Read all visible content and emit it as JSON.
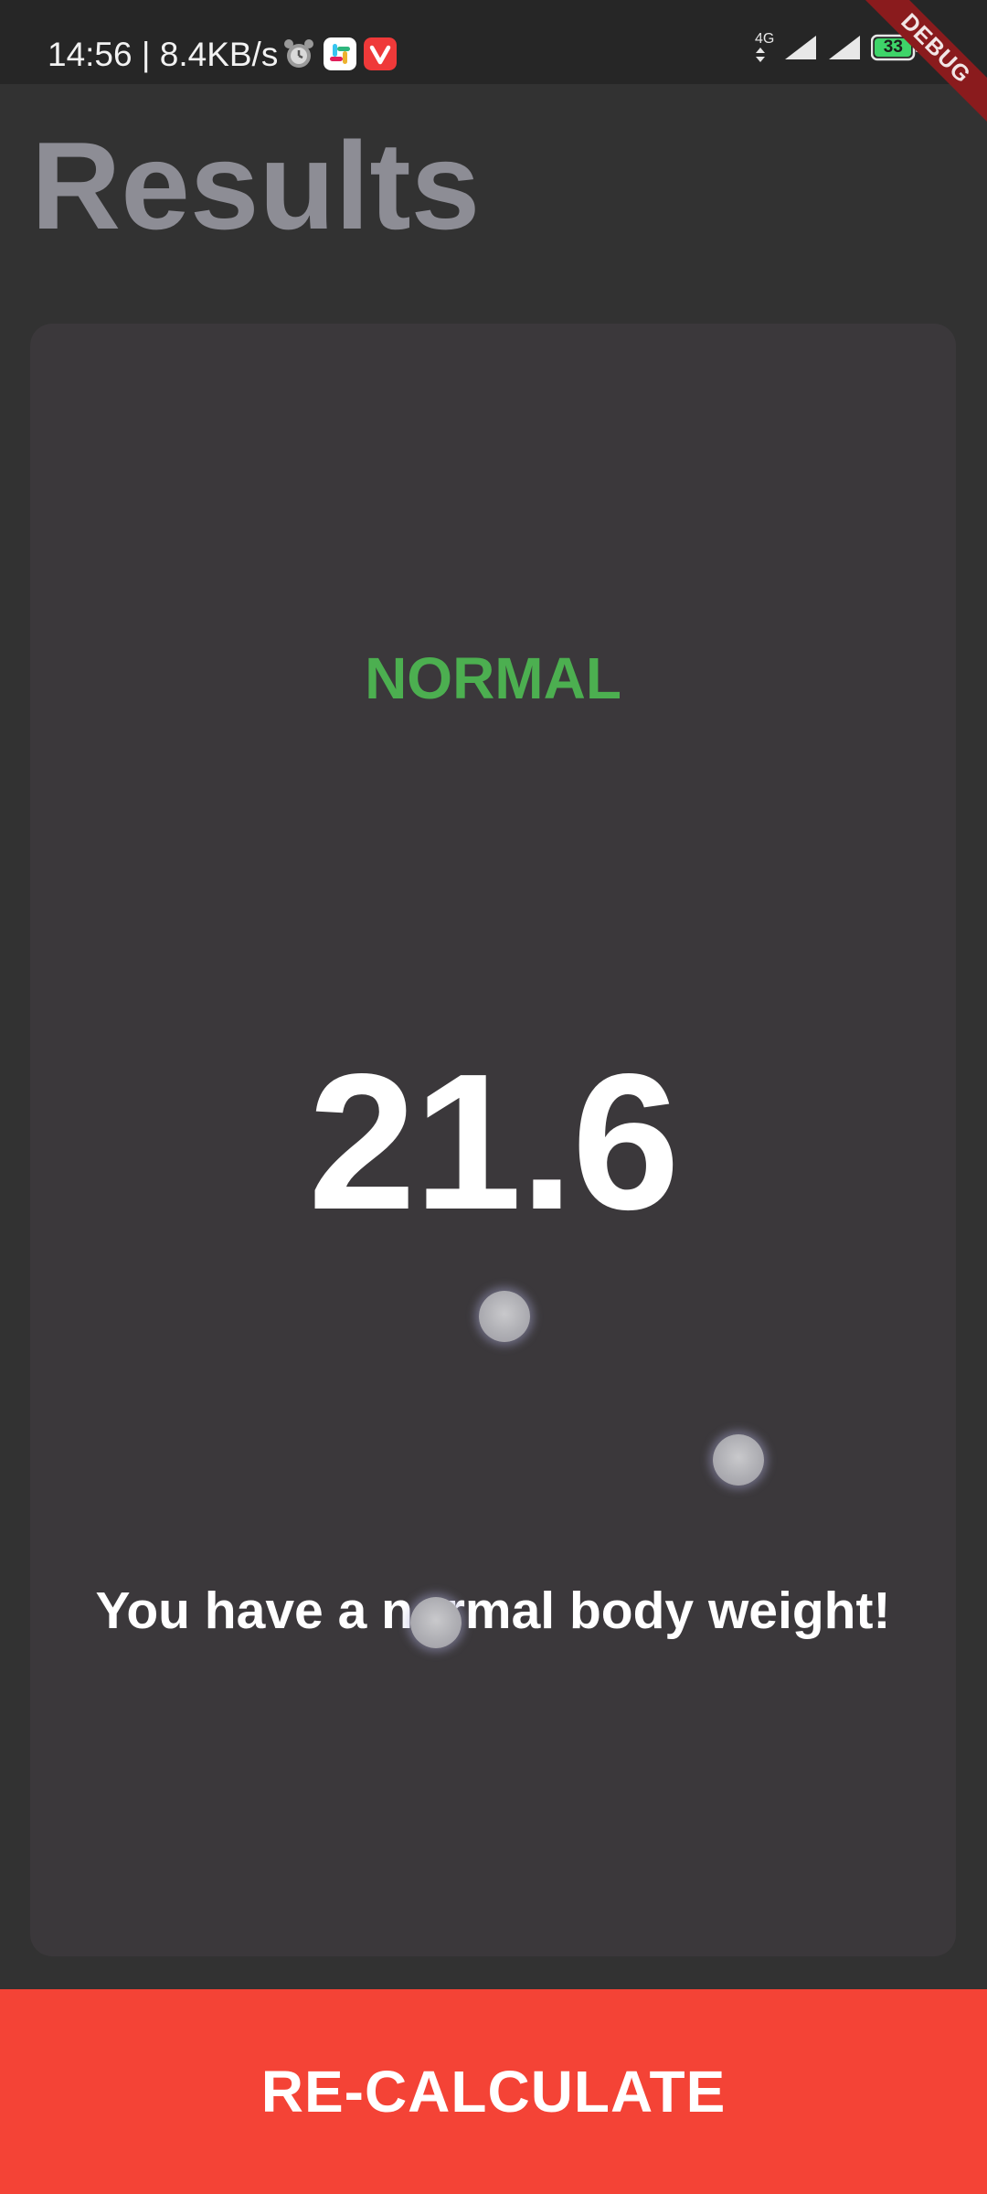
{
  "status_bar": {
    "time_speed": "14:56 | 8.4KB/s",
    "network_type": "4G",
    "battery_level": "33",
    "app_icons": [
      "alarm-icon",
      "slack-icon",
      "vivaldi-icon"
    ]
  },
  "debug_banner": "DEBUG",
  "page": {
    "title": "Results"
  },
  "result": {
    "status": "NORMAL",
    "value": "21.6",
    "message": "You have a normal body weight!"
  },
  "button": {
    "label": "RE-CALCULATE"
  },
  "colors": {
    "background": "#323232",
    "card": "#3b383b",
    "title": "#8d8d95",
    "status_green": "#4caf50",
    "button_red": "#f44336"
  }
}
